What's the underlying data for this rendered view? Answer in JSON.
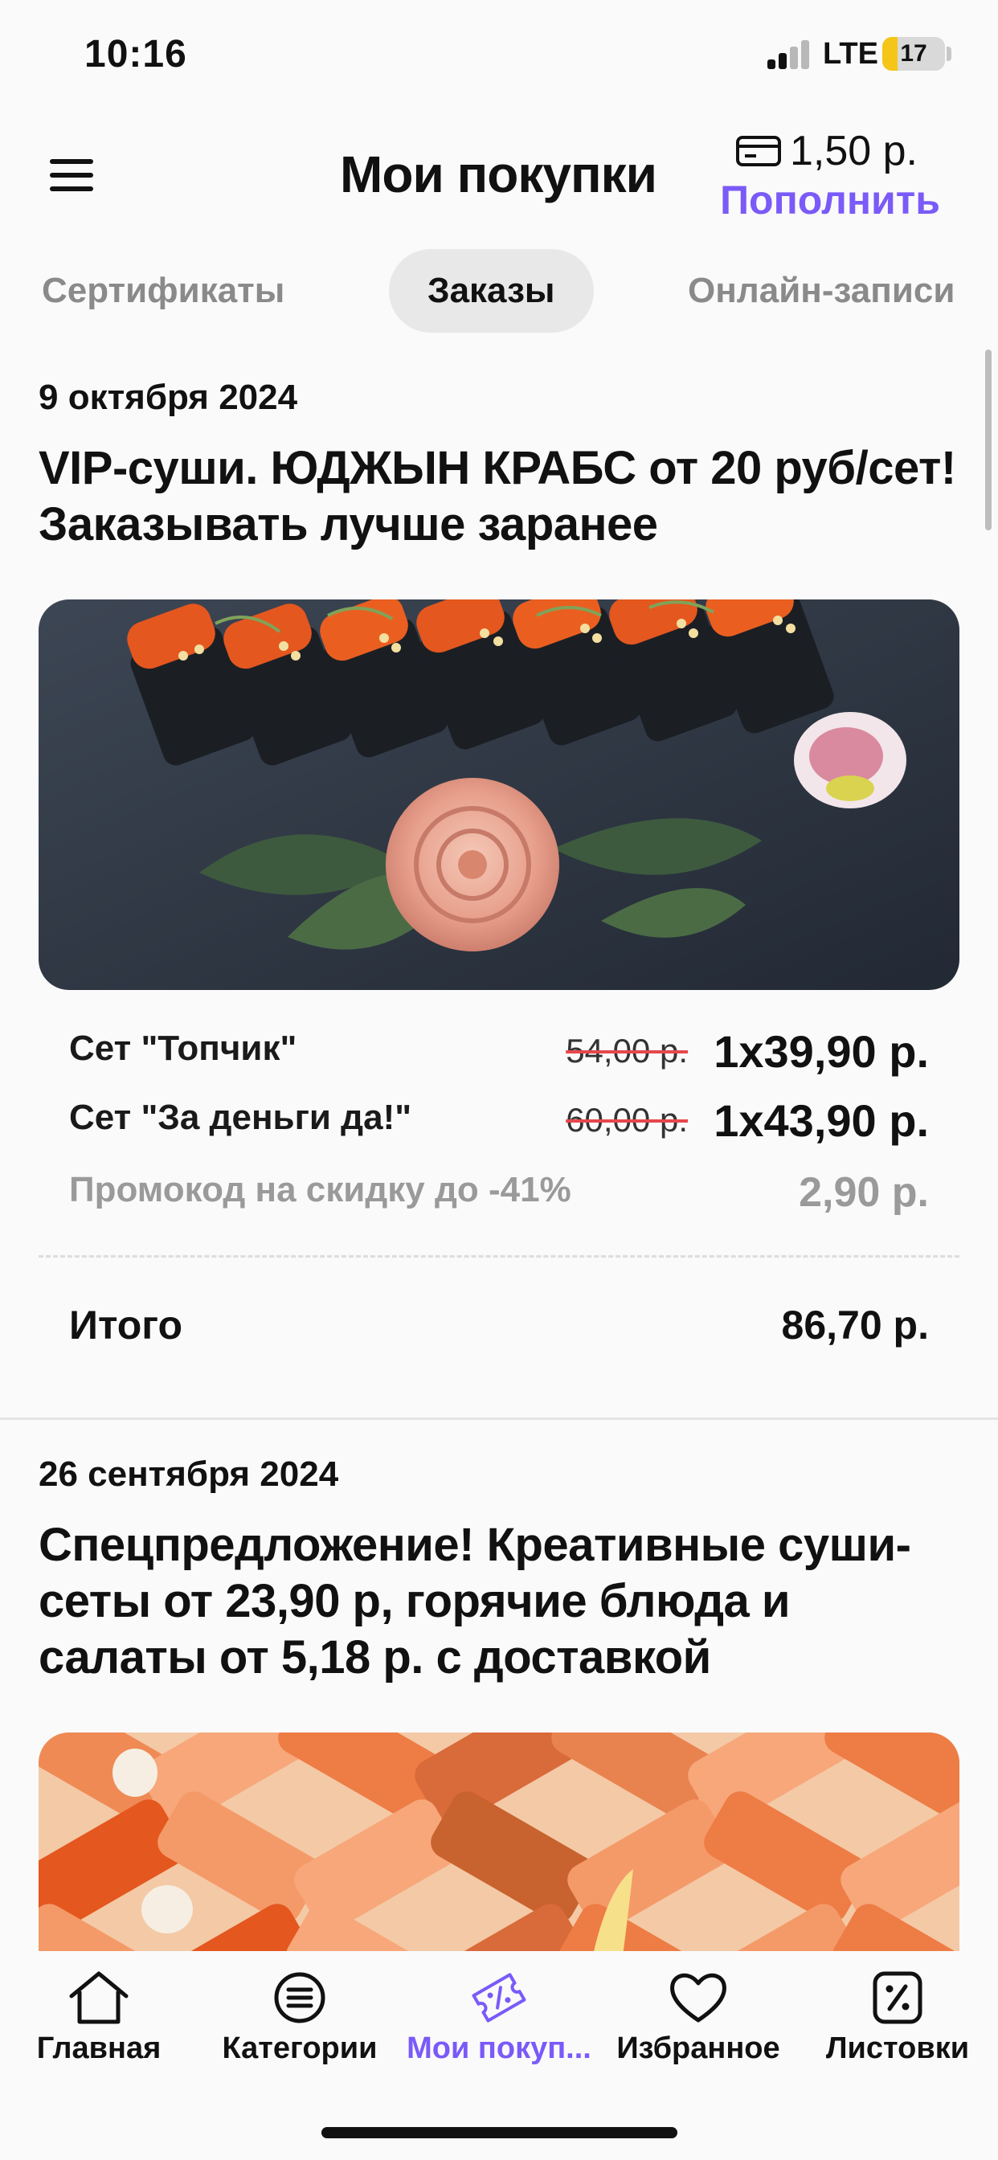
{
  "status_bar": {
    "time": "10:16",
    "network": "LTE",
    "battery": "17"
  },
  "header": {
    "title": "Мои покупки",
    "balance": "1,50 р.",
    "topup": "Пополнить"
  },
  "tabs": [
    "Сертификаты",
    "Заказы",
    "Онлайн-записи"
  ],
  "orders": [
    {
      "date": "9 октября 2024",
      "title": "VIP-суши. ЮДЖЫН КРАБС от 20 руб/сет! Заказывать лучше заранее",
      "items": [
        {
          "name": "Сет \"Топчик\"",
          "old_price": "54,00 р.",
          "qty_price": "1x39,90 р."
        },
        {
          "name": "Сет \"За деньги да!\"",
          "old_price": "60,00 р.",
          "qty_price": "1x43,90 р."
        }
      ],
      "promo": {
        "name": "Промокод на скидку до -41%",
        "value": "2,90 р."
      },
      "total_label": "Итого",
      "total_value": "86,70 р."
    },
    {
      "date": "26 сентября 2024",
      "title": "Спецпредложение! Креативные суши-сеты от 23,90 р, горячие блюда и салаты от 5,18 р. с доставкой"
    }
  ],
  "tabbar": [
    {
      "label": "Главная",
      "icon": "home-icon"
    },
    {
      "label": "Категории",
      "icon": "categories-icon"
    },
    {
      "label": "Мои покуп...",
      "icon": "purchases-icon"
    },
    {
      "label": "Избранное",
      "icon": "heart-icon"
    },
    {
      "label": "Листовки",
      "icon": "leaflets-icon"
    }
  ],
  "colors": {
    "accent": "#7a5af8",
    "strike": "#e5484d"
  }
}
